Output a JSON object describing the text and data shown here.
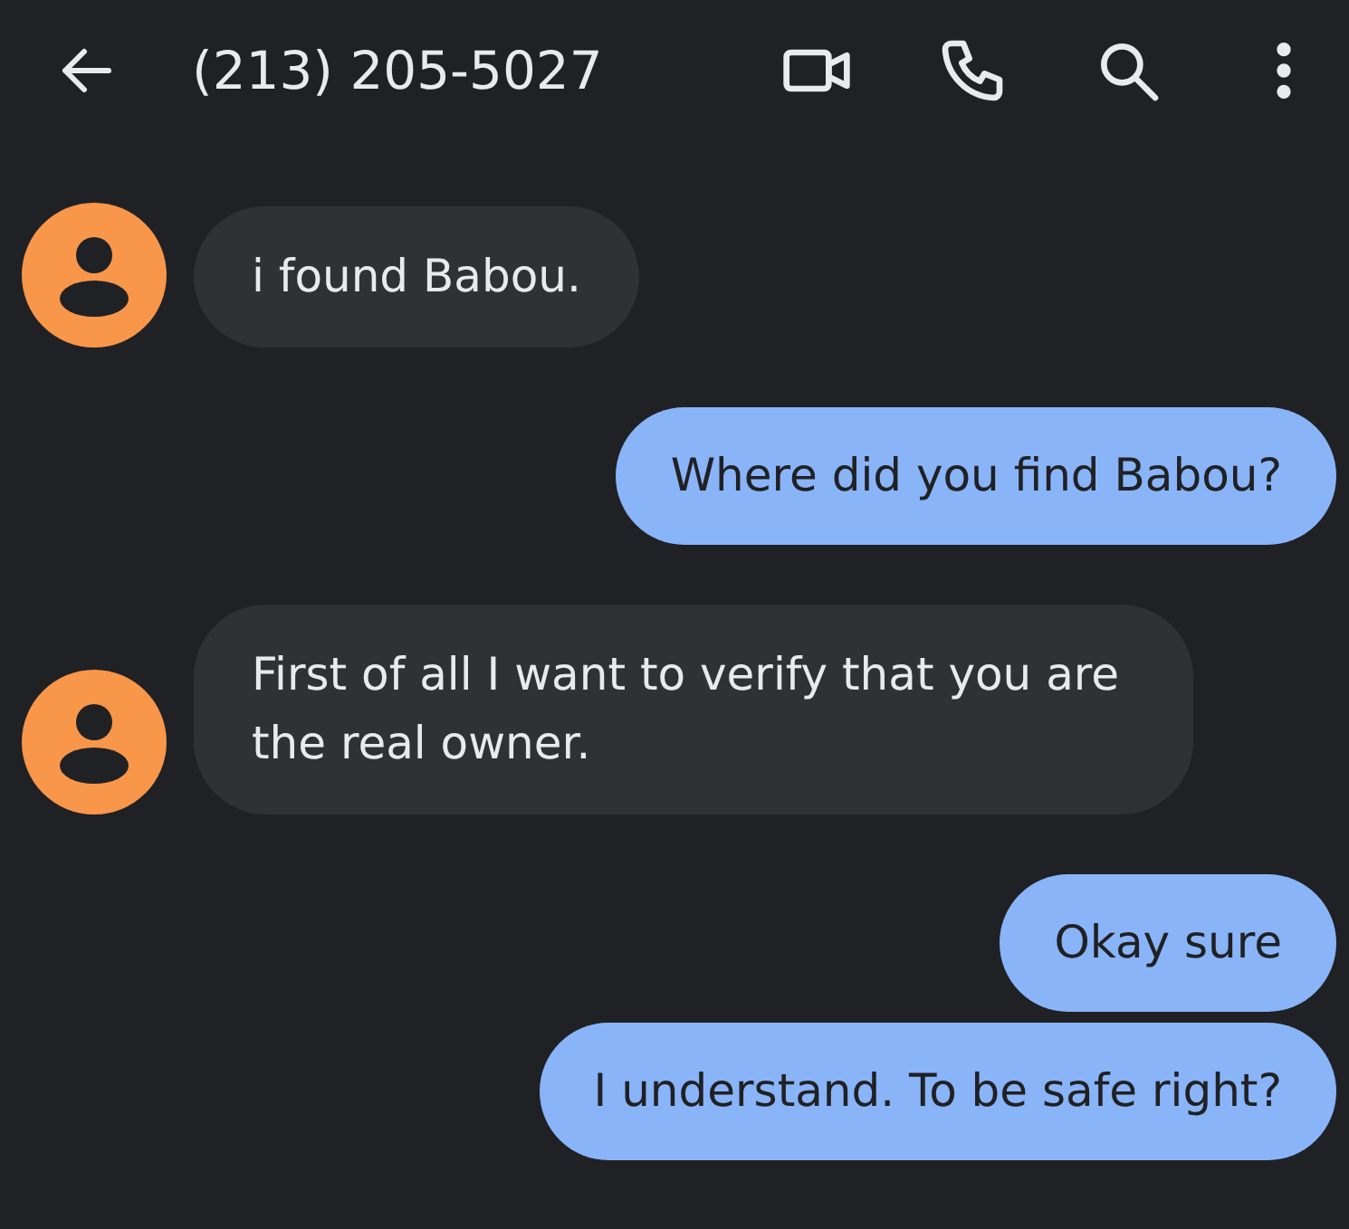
{
  "header": {
    "title": "(213) 205-5027"
  },
  "messages": [
    {
      "kind": "received",
      "text": "i found Babou."
    },
    {
      "kind": "sent",
      "text": "Where did you find Babou?"
    },
    {
      "kind": "received",
      "text": "First of all I want to verify that you are the real owner."
    },
    {
      "kind": "sent",
      "text": "Okay sure"
    },
    {
      "kind": "sent",
      "text": "I understand. To be safe right?"
    }
  ]
}
